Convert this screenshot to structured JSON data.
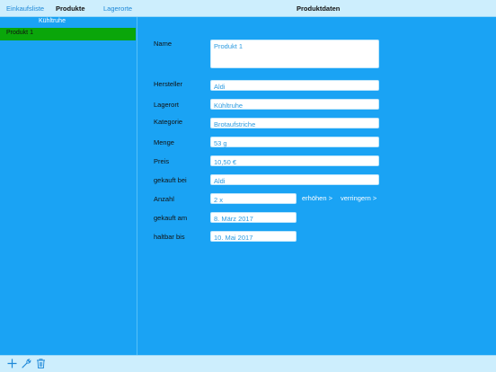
{
  "nav": {
    "tabs": [
      {
        "label": "Einkaufsliste"
      },
      {
        "label": "Produkte"
      },
      {
        "label": "Lagerorte"
      }
    ],
    "detail_title": "Produktdaten"
  },
  "list": {
    "section_header": "Kühltruhe",
    "items": [
      {
        "label": "Produkt 1",
        "selected": true
      }
    ]
  },
  "form": {
    "name": {
      "label": "Name",
      "value": "Produkt 1"
    },
    "hersteller": {
      "label": "Hersteller",
      "value": "Aldi"
    },
    "lagerort": {
      "label": "Lagerort",
      "value": "Kühltruhe"
    },
    "kategorie": {
      "label": "Kategorie",
      "value": "Brotaufstriche"
    },
    "menge": {
      "label": "Menge",
      "value": "53 g"
    },
    "preis": {
      "label": "Preis",
      "value": "10,50 €"
    },
    "gekauft_bei": {
      "label": "gekauft bei",
      "value": "Aldi"
    },
    "anzahl": {
      "label": "Anzahl",
      "value": "2 x",
      "increase": "erhöhen >",
      "decrease": "verringern >"
    },
    "gekauft_am": {
      "label": "gekauft am",
      "value": "8. März 2017"
    },
    "haltbar_bis": {
      "label": "haltbar bis",
      "value": "10. Mai 2017"
    }
  },
  "toolbar": {
    "icons": [
      "plus-icon",
      "wrench-icon",
      "trash-icon"
    ]
  },
  "colors": {
    "background": "#1aa3f4",
    "bars": "#cdeefd",
    "selection": "#0aa60a",
    "link": "#1e88d8"
  }
}
